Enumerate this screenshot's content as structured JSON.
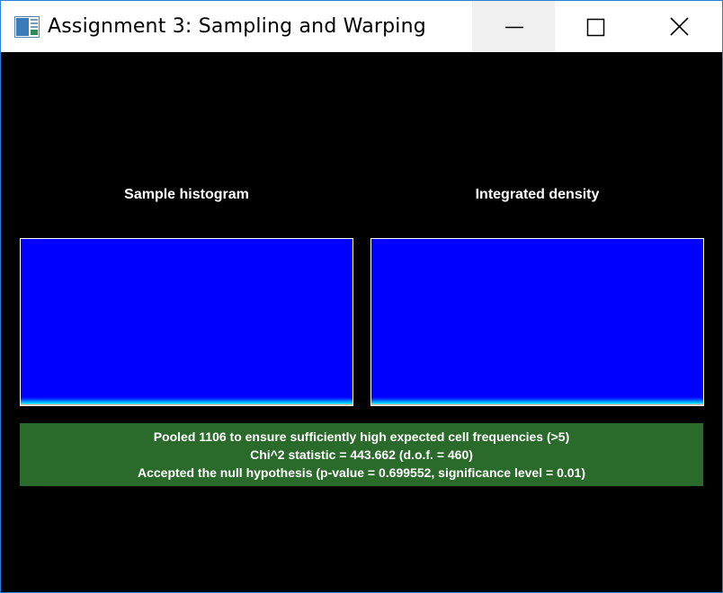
{
  "window": {
    "title": "Assignment 3: Sampling and Warping",
    "controls": {
      "minimize": "minimize-icon",
      "maximize": "maximize-icon",
      "close": "close-icon"
    }
  },
  "panels": {
    "left_title": "Sample histogram",
    "right_title": "Integrated density"
  },
  "result": {
    "line1": "Pooled 1106 to ensure sufficiently high expected cell frequencies (>5)",
    "line2": "Chi^2 statistic = 443.662 (d.o.f. = 460)",
    "line3": "Accepted the null hypothesis (p-value = 0.699552, significance level = 0.01)",
    "background_color": "#2a6a2a"
  },
  "colors": {
    "plot_fill": "#0000ff",
    "window_border": "#2b7fd6"
  }
}
